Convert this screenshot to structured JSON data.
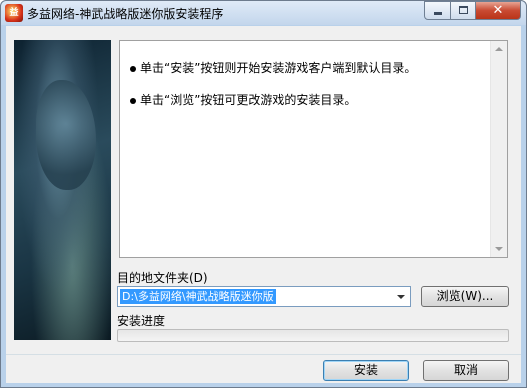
{
  "window": {
    "title": "多益网络-神武战略版迷你版安装程序",
    "app_icon_text": "益",
    "close_glyph": "✕"
  },
  "info": {
    "line1": "单击“安装”按钮则开始安装游戏客户端到默认目录。",
    "line2": "单击“浏览”按钮可更改游戏的安装目录。"
  },
  "destination": {
    "label": "目的地文件夹(D)",
    "path": "D:\\多益网络\\神武战略版迷你版"
  },
  "buttons": {
    "browse": "浏览(W)...",
    "install": "安装",
    "cancel": "取消"
  },
  "progress": {
    "label": "安装进度",
    "value": 0
  },
  "colors": {
    "selection": "#3399ff",
    "progress_fill": "#06b025",
    "frame": "#b9d1ea"
  }
}
